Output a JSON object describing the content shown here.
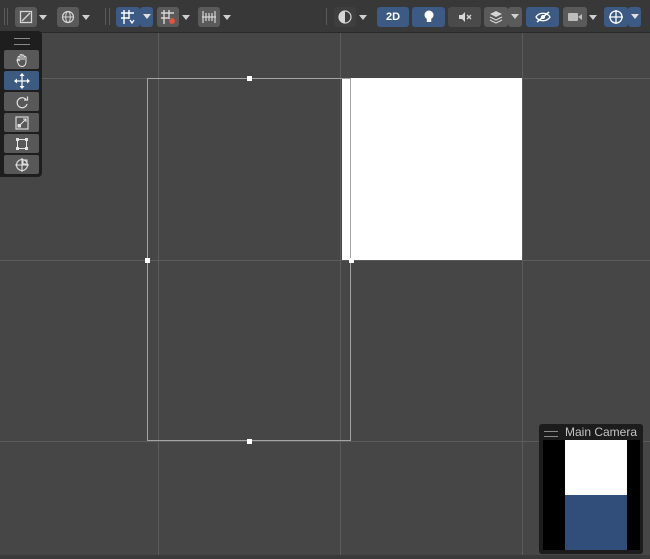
{
  "toolbar": {
    "buttons": [
      {
        "name": "draw-mode-icon",
        "active": false,
        "dropdown": true
      },
      {
        "name": "gizmo-globe-icon",
        "active": false,
        "dropdown": true
      },
      {
        "name": "grid-snap-icon",
        "active": true,
        "dropdown": true
      },
      {
        "name": "increment-snap-icon",
        "active": false,
        "dropdown": true
      },
      {
        "name": "snap-settings-icon",
        "active": false,
        "dropdown": true
      },
      {
        "name": "shading-icon",
        "active": false,
        "dropdown": true
      },
      {
        "name": "lighting-bulb-icon",
        "active": true,
        "dropdown": false
      },
      {
        "name": "audio-mute-icon",
        "active": false,
        "dropdown": false
      },
      {
        "name": "effects-layers-icon",
        "active": false,
        "dropdown": true
      },
      {
        "name": "hidden-visibility-icon",
        "active": true,
        "dropdown": false
      },
      {
        "name": "scene-camera-icon",
        "active": false,
        "dropdown": true
      },
      {
        "name": "gizmos-icon",
        "active": true,
        "dropdown": true
      }
    ],
    "mode_2d_label": "2D"
  },
  "tool_palette": {
    "tools": [
      {
        "name": "hand-tool-icon",
        "active": false
      },
      {
        "name": "move-tool-icon",
        "active": true
      },
      {
        "name": "rotate-tool-icon",
        "active": false
      },
      {
        "name": "scale-tool-icon",
        "active": false
      },
      {
        "name": "rect-tool-icon",
        "active": false
      },
      {
        "name": "transform-tool-icon",
        "active": false
      }
    ]
  },
  "camera_preview": {
    "title": "Main Camera",
    "sky_color": "#ffffff",
    "ground_color": "#314d79"
  },
  "colors": {
    "background": "#464646",
    "toolbar": "#383838",
    "accent_active": "#3c5a83",
    "sprite": "#ffffff"
  }
}
